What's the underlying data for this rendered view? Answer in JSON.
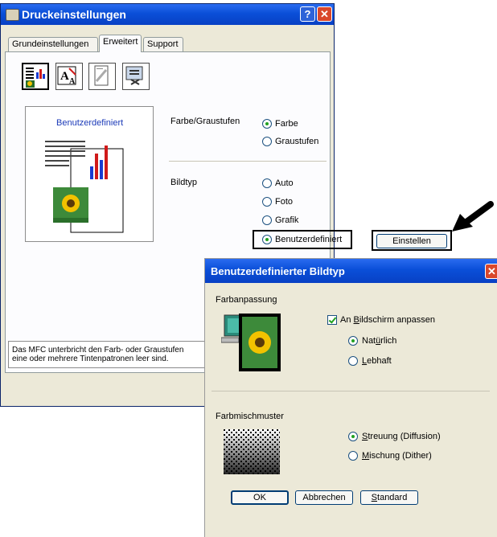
{
  "main_dialog": {
    "title": "Druckeinstellungen",
    "tabs": [
      "Grundeinstellungen",
      "Erweitert",
      "Support"
    ],
    "active_tab": "Erweitert",
    "icons": [
      "color-settings-icon",
      "scaling-icon",
      "watermark-icon",
      "device-options-icon"
    ],
    "preview_label": "Benutzerdefiniert",
    "color_label": "Farbe/Graustufen",
    "color_options": [
      "Farbe",
      "Graustufen"
    ],
    "color_selected": "Farbe",
    "image_type_label": "Bildtyp",
    "image_type_options": [
      "Auto",
      "Foto",
      "Grafik",
      "Benutzerdefiniert"
    ],
    "image_type_selected": "Benutzerdefiniert",
    "settings_button": "Einstellen",
    "note_line1": "Das MFC unterbricht den Farb- oder Graustufen",
    "note_line2": "eine oder mehrere Tintenpatronen leer sind."
  },
  "sub_dialog": {
    "title": "Benutzerdefinierter Bildtyp",
    "color_matching_label": "Farbanpassung",
    "match_screen": {
      "pre": "An ",
      "u": "B",
      "post": "ildschirm anpassen",
      "checked": true
    },
    "natural": {
      "pre": "Nat",
      "u": "ü",
      "post": "rlich",
      "selected": true
    },
    "vivid": {
      "pre": "",
      "u": "L",
      "post": "ebhaft",
      "selected": false
    },
    "halftone_label": "Farbmischmuster",
    "diffusion": {
      "pre": "",
      "u": "S",
      "post": "treuung (Diffusion)",
      "selected": true
    },
    "dither": {
      "pre": "",
      "u": "M",
      "post": "ischung (Dither)",
      "selected": false
    },
    "ok_button": "OK",
    "cancel_button": "Abbrechen",
    "default_button": {
      "pre": "",
      "u": "S",
      "post": "tandard"
    }
  },
  "colors": {
    "title_blue": "#0a4fd8",
    "close_red": "#d9472b",
    "radio_green": "#21a121"
  }
}
